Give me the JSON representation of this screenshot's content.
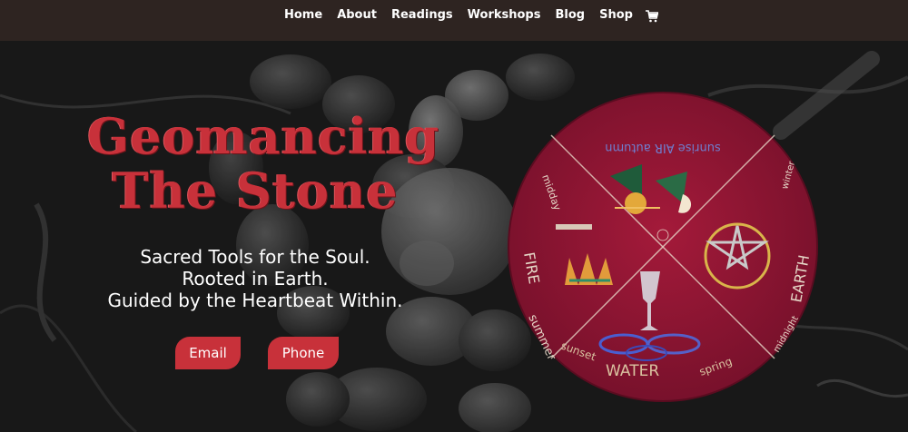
{
  "nav": {
    "items": [
      "Home",
      "About",
      "Readings",
      "Workshops",
      "Blog",
      "Shop"
    ],
    "cart_icon": "shopping-cart-icon"
  },
  "hero": {
    "title_line1": "Geomancing",
    "title_line2": "The Stone",
    "tagline": [
      "Sacred Tools for the Soul.",
      "Rooted in Earth.",
      "Guided by the Heartbeat Within."
    ],
    "email_label": "Email",
    "phone_label": "Phone"
  },
  "cloth": {
    "top": "sunrise AIR autumn",
    "fire": "FIRE",
    "midday": "midday",
    "summer": "summer",
    "earth": "EARTH",
    "winter": "winter",
    "midnight": "midnight",
    "water": "WATER",
    "sunset": "sunset",
    "spring": "spring"
  },
  "colors": {
    "accent": "#c8313a",
    "topbar": "#2e2421",
    "cloth": "#8e1530"
  }
}
